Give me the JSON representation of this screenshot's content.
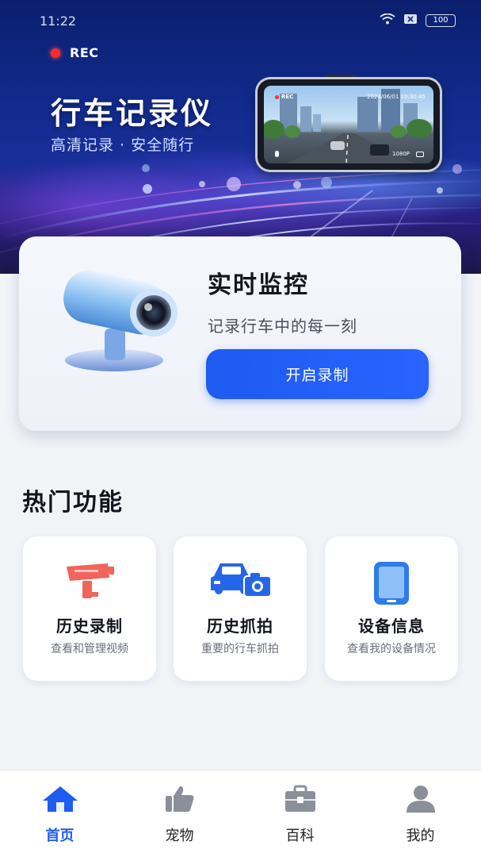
{
  "status_bar": {
    "time": "11:22",
    "battery": "100"
  },
  "hero": {
    "rec_label": "REC",
    "title": "行车记录仪",
    "subtitle": "高清记录 · 安全随行",
    "dashcam": {
      "rec_label": "REC",
      "datetime": "2024/06/01  10:30:45",
      "resolution": "1080P"
    }
  },
  "live_card": {
    "title": "实时监控",
    "subtitle": "记录行车中的每一刻",
    "button_label": "开启录制"
  },
  "hot_features": {
    "title": "热门功能",
    "items": [
      {
        "title": "历史录制",
        "desc": "查看和管理视频",
        "icon": "cctv-camera-icon",
        "color": "#f0645c"
      },
      {
        "title": "历史抓拍",
        "desc": "重要的行车抓拍",
        "icon": "car-camera-icon",
        "color": "#2566e8"
      },
      {
        "title": "设备信息",
        "desc": "查看我的设备情况",
        "icon": "phone-device-icon",
        "color": "#2f7be8"
      }
    ]
  },
  "tab_bar": {
    "items": [
      {
        "label": "首页",
        "icon": "home-icon",
        "active": true
      },
      {
        "label": "宠物",
        "icon": "thumbs-up-icon",
        "active": false
      },
      {
        "label": "百科",
        "icon": "briefcase-icon",
        "active": false
      },
      {
        "label": "我的",
        "icon": "user-icon",
        "active": false
      }
    ]
  },
  "colors": {
    "accent": "#1f5cf0",
    "hero_dark": "#0b1f6e",
    "background": "#f1f3f7",
    "rec_red": "#ff2b2b"
  }
}
